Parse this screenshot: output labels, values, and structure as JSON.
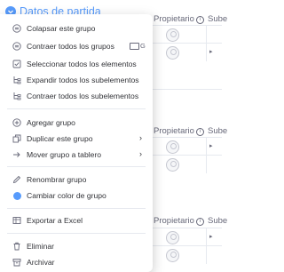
{
  "group": {
    "title": "Datos de partida",
    "color": "#579bfc"
  },
  "columns": {
    "owner": "Propietario",
    "subitems": "Sube"
  },
  "menu": {
    "items": [
      {
        "id": "collapse-group",
        "label": "Colapsar este grupo",
        "icon": "collapse-icon"
      },
      {
        "id": "collapse-all-groups",
        "label": "Contraer todos los grupos",
        "icon": "collapse-all-icon",
        "shortcut": "G"
      },
      {
        "id": "select-all-items",
        "label": "Seleccionar todos los elementos",
        "icon": "checkbox-icon"
      },
      {
        "id": "expand-all-subitems",
        "label": "Expandir todos los subelementos",
        "icon": "subitems-icon"
      },
      {
        "id": "collapse-all-subitems",
        "label": "Contraer todos los subelementos",
        "icon": "subitems-icon"
      },
      {
        "id": "add-group",
        "label": "Agregar grupo",
        "icon": "add-circle-icon"
      },
      {
        "id": "duplicate-group",
        "label": "Duplicar este grupo",
        "icon": "duplicate-icon",
        "submenu": true
      },
      {
        "id": "move-group",
        "label": "Mover grupo a tablero",
        "icon": "move-icon",
        "submenu": true
      },
      {
        "id": "rename-group",
        "label": "Renombrar grupo",
        "icon": "pencil-icon"
      },
      {
        "id": "change-group-color",
        "label": "Cambiar color de grupo",
        "icon": "color-dot-icon"
      },
      {
        "id": "export-excel",
        "label": "Exportar a Excel",
        "icon": "excel-icon"
      },
      {
        "id": "delete",
        "label": "Eliminar",
        "icon": "trash-icon"
      },
      {
        "id": "archive",
        "label": "Archivar",
        "icon": "archive-icon"
      }
    ]
  }
}
